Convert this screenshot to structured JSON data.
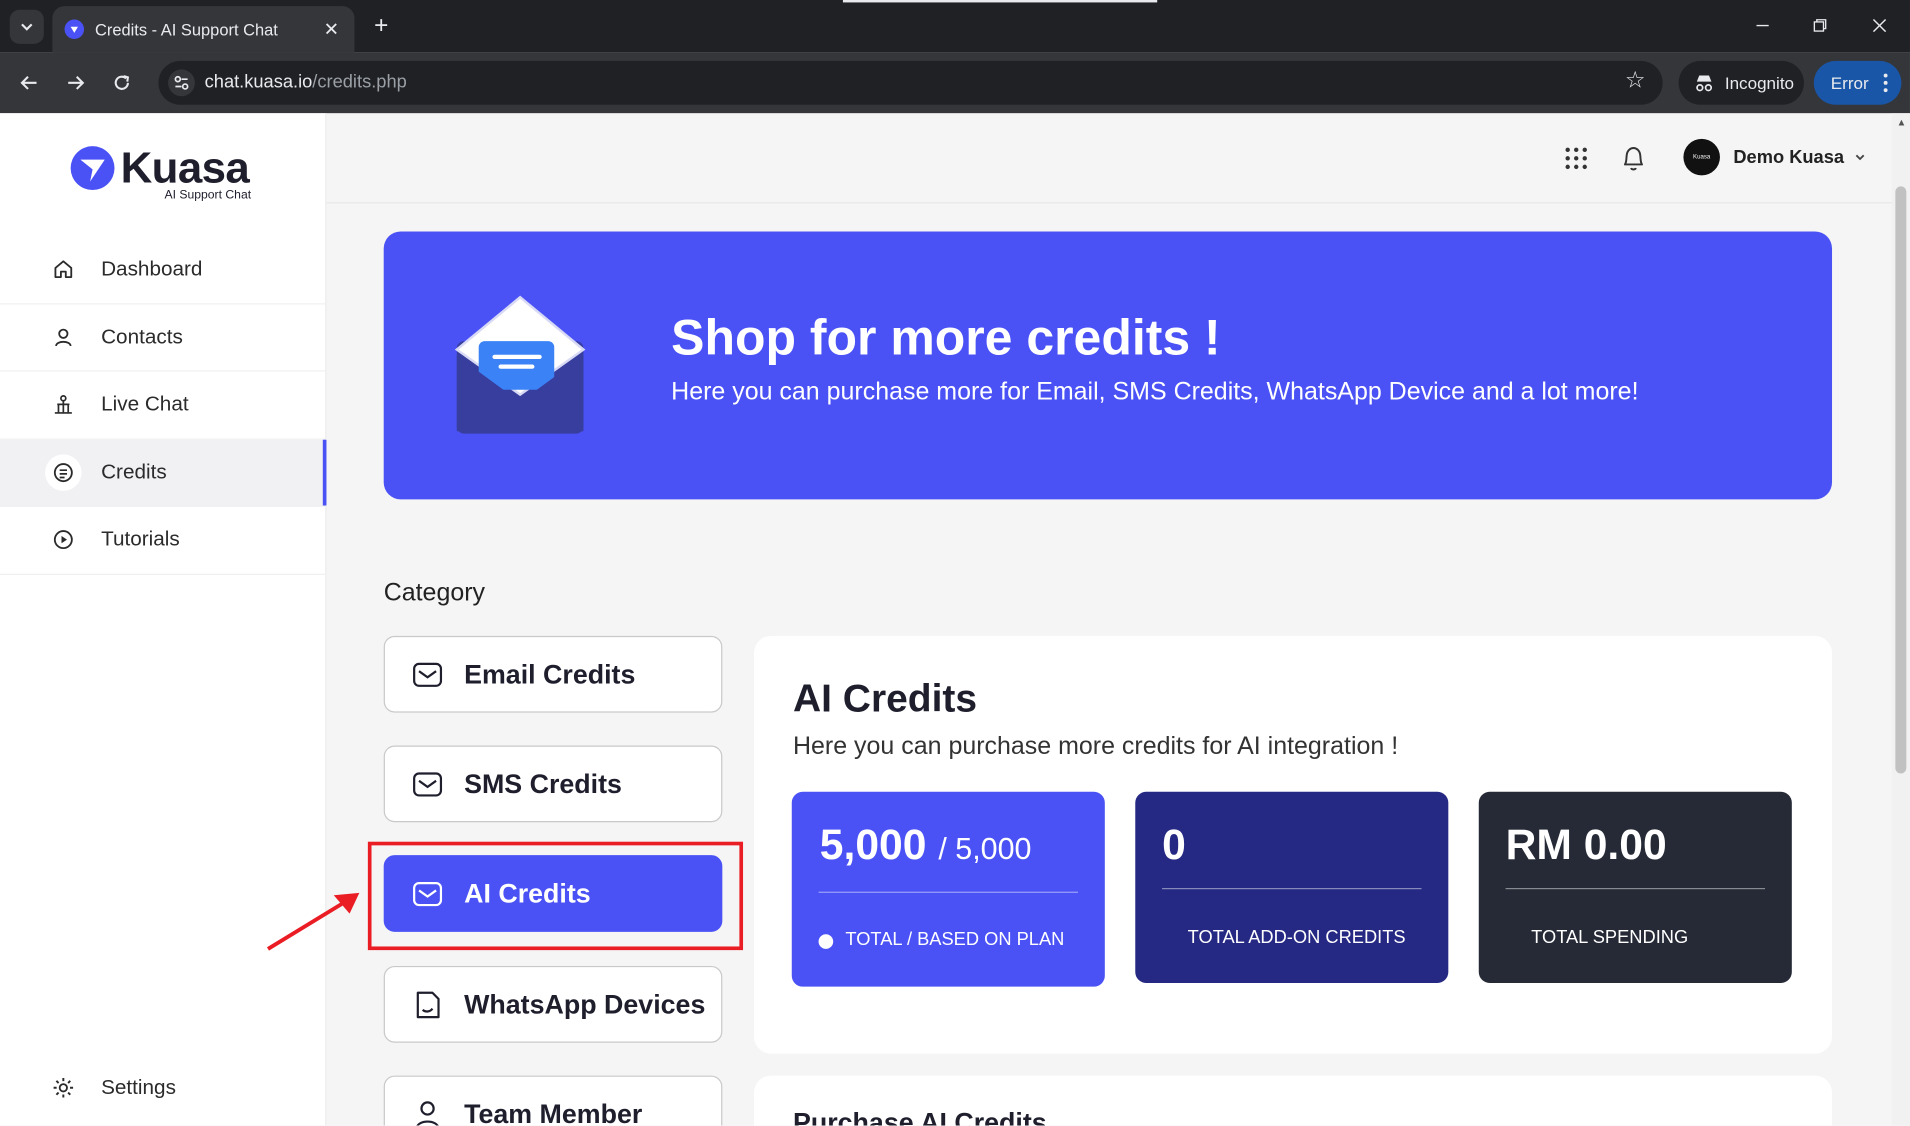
{
  "browser": {
    "tab_title": "Credits - AI Support Chat",
    "url_host": "chat.kuasa.io",
    "url_path": "/credits.php",
    "incognito_label": "Incognito",
    "error_label": "Error"
  },
  "brand": {
    "name": "Kuasa",
    "tagline": "AI Support Chat",
    "accent_color": "#4a52f5"
  },
  "sidebar": {
    "items": [
      {
        "label": "Dashboard",
        "icon": "home-icon"
      },
      {
        "label": "Contacts",
        "icon": "user-icon"
      },
      {
        "label": "Live Chat",
        "icon": "live-chat-icon"
      },
      {
        "label": "Credits",
        "icon": "credits-icon",
        "active": true
      },
      {
        "label": "Tutorials",
        "icon": "play-icon"
      }
    ],
    "settings_label": "Settings"
  },
  "header": {
    "user_name": "Demo Kuasa",
    "avatar_text": "Kuasa"
  },
  "banner": {
    "title": "Shop for more credits !",
    "subtitle": "Here you can purchase more for Email, SMS Credits, WhatsApp Device and a lot more!"
  },
  "category": {
    "label": "Category",
    "items": [
      {
        "label": "Email Credits",
        "icon": "mail-icon"
      },
      {
        "label": "SMS Credits",
        "icon": "mail-icon"
      },
      {
        "label": "AI Credits",
        "icon": "mail-icon",
        "active": true
      },
      {
        "label": "WhatsApp Devices",
        "icon": "device-icon"
      },
      {
        "label": "Team Member",
        "icon": "user-icon"
      }
    ]
  },
  "panel": {
    "title": "AI Credits",
    "subtitle": "Here you can purchase more credits for AI integration !",
    "stats": [
      {
        "value": "5,000",
        "suffix": "/ 5,000",
        "label": "TOTAL / BASED ON PLAN",
        "color": "#4a52f5"
      },
      {
        "value": "0",
        "label": "TOTAL ADD-ON CREDITS",
        "color": "#262983"
      },
      {
        "value": "RM 0.00",
        "label": "TOTAL SPENDING",
        "color": "#262a36"
      }
    ]
  },
  "purchase_panel": {
    "title": "Purchase AI Credits"
  },
  "annotation": {
    "highlight_color": "#ea1c24"
  }
}
